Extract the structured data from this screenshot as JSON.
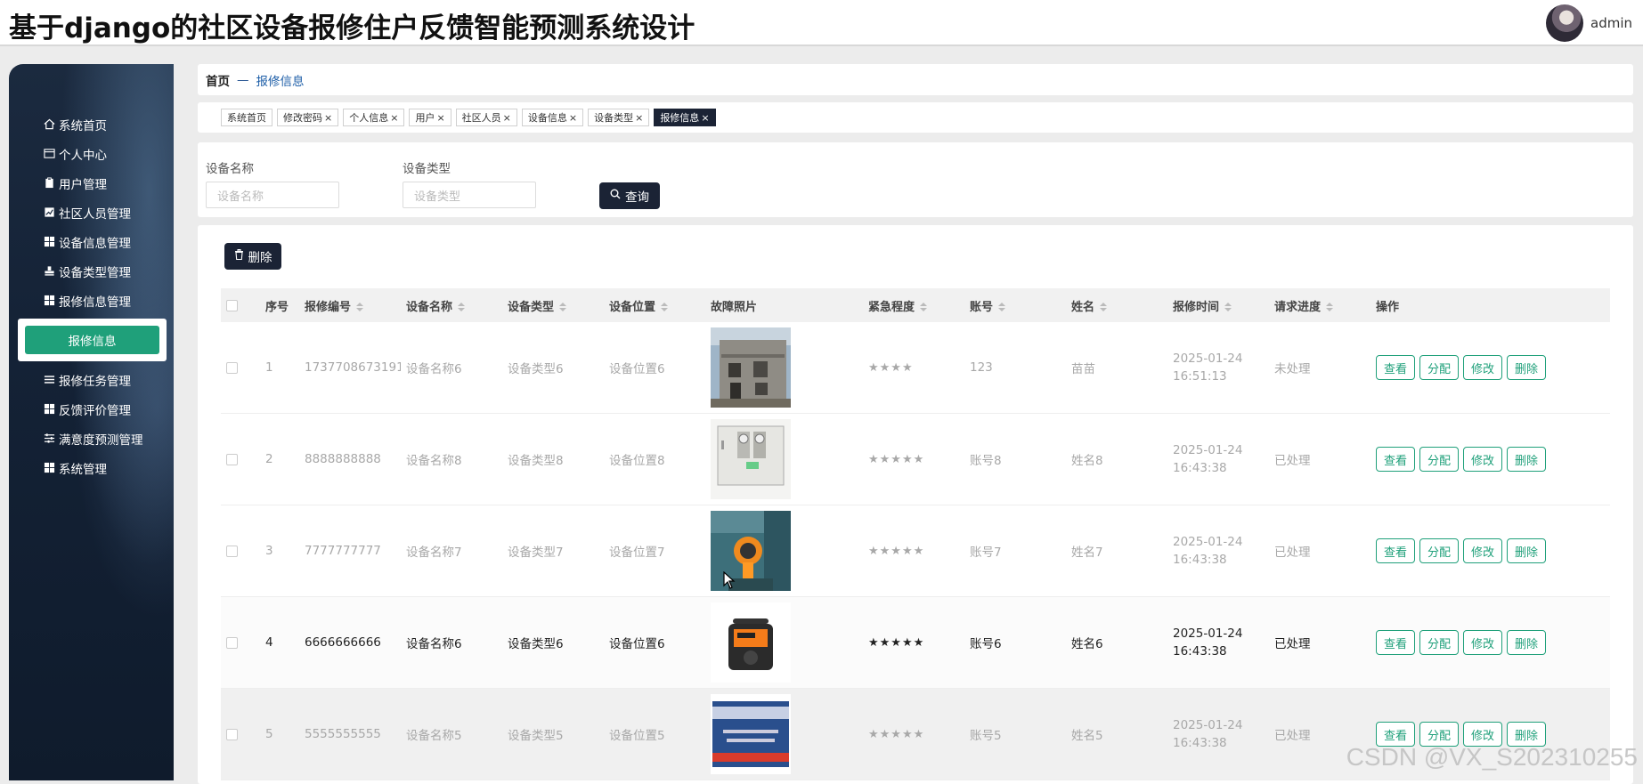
{
  "app": {
    "title": "基于django的社区设备报修住户反馈智能预测系统设计",
    "user_name": "admin"
  },
  "sidebar": {
    "items": [
      {
        "label": "系统首页",
        "icon": "home-icon"
      },
      {
        "label": "个人中心",
        "icon": "card-icon"
      },
      {
        "label": "用户管理",
        "icon": "clipboard-icon"
      },
      {
        "label": "社区人员管理",
        "icon": "chart-icon"
      },
      {
        "label": "设备信息管理",
        "icon": "grid-icon"
      },
      {
        "label": "设备类型管理",
        "icon": "stamp-icon"
      },
      {
        "label": "报修信息管理",
        "icon": "grid-icon"
      }
    ],
    "active_sub": "报修信息",
    "items_after": [
      {
        "label": "报修任务管理",
        "icon": "list-icon"
      },
      {
        "label": "反馈评价管理",
        "icon": "grid-icon"
      },
      {
        "label": "满意度预测管理",
        "icon": "sliders-icon"
      },
      {
        "label": "系统管理",
        "icon": "grid-icon"
      }
    ]
  },
  "breadcrumb": {
    "home": "首页",
    "separator": "—",
    "current": "报修信息"
  },
  "tabs": [
    {
      "label": "系统首页",
      "closable": false
    },
    {
      "label": "修改密码",
      "closable": true
    },
    {
      "label": "个人信息",
      "closable": true
    },
    {
      "label": "用户",
      "closable": true
    },
    {
      "label": "社区人员",
      "closable": true
    },
    {
      "label": "设备信息",
      "closable": true
    },
    {
      "label": "设备类型",
      "closable": true
    },
    {
      "label": "报修信息",
      "closable": true,
      "active": true
    }
  ],
  "search": {
    "device_name_label": "设备名称",
    "device_name_placeholder": "设备名称",
    "device_type_label": "设备类型",
    "device_type_placeholder": "设备类型",
    "query_button": "查询"
  },
  "toolbar": {
    "delete_button": "删除"
  },
  "table": {
    "headers": [
      "序号",
      "报修编号",
      "设备名称",
      "设备类型",
      "设备位置",
      "故障照片",
      "紧急程度",
      "账号",
      "姓名",
      "报修时间",
      "请求进度",
      "操作"
    ],
    "rows": [
      {
        "index": "1",
        "code": "1737708673191",
        "name": "设备名称6",
        "type": "设备类型6",
        "location": "设备位置6",
        "photo": "building",
        "urgency": "★★★★",
        "account": "123",
        "person": "苗苗",
        "time": "2025-01-24 16:51:13",
        "progress": "未处理"
      },
      {
        "index": "2",
        "code": "8888888888",
        "name": "设备名称8",
        "type": "设备类型8",
        "location": "设备位置8",
        "photo": "cabinet",
        "urgency": "★★★★★",
        "account": "账号8",
        "person": "姓名8",
        "time": "2025-01-24 16:43:38",
        "progress": "已处理"
      },
      {
        "index": "3",
        "code": "7777777777",
        "name": "设备名称7",
        "type": "设备类型7",
        "location": "设备位置7",
        "photo": "detector",
        "urgency": "★★★★★",
        "account": "账号7",
        "person": "姓名7",
        "time": "2025-01-24 16:43:38",
        "progress": "已处理"
      },
      {
        "index": "4",
        "code": "6666666666",
        "name": "设备名称6",
        "type": "设备类型6",
        "location": "设备位置6",
        "photo": "speaker",
        "urgency": "★★★★★",
        "account": "账号6",
        "person": "姓名6",
        "time": "2025-01-24 16:43:38",
        "progress": "已处理"
      },
      {
        "index": "5",
        "code": "5555555555",
        "name": "设备名称5",
        "type": "设备类型5",
        "location": "设备位置5",
        "photo": "sign",
        "urgency": "★★★★★",
        "account": "账号5",
        "person": "姓名5",
        "time": "2025-01-24 16:43:38",
        "progress": "已处理"
      }
    ],
    "actions": [
      "查看",
      "分配",
      "修改",
      "删除"
    ]
  },
  "watermark": "CSDN @VX_S202310255",
  "colors": {
    "accent": "#1fa07a",
    "dark": "#1b2335"
  }
}
